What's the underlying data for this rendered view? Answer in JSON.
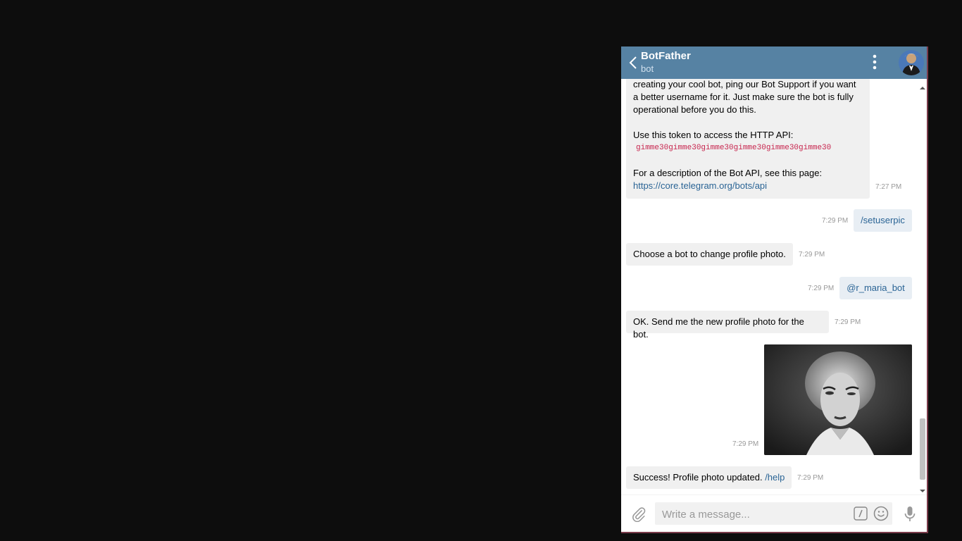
{
  "header": {
    "title": "BotFather",
    "subtitle": "bot",
    "back_icon": "chevron-left-icon",
    "menu_icon": "vertical-dots-icon",
    "bg_color": "#5682a3"
  },
  "messages": [
    {
      "id": "m1",
      "direction": "in",
      "lines": [
        "creating your cool bot, ping our Bot Support if you want",
        "a better username for it. Just make sure the bot is fully",
        "operational before you do this."
      ],
      "token_label": "Use this token to access the HTTP API:",
      "token": "gimme30gimme30gimme30gimme30gimme30gimme30",
      "api_label": "For a description of the Bot API, see this page:",
      "api_link": "https://core.telegram.org/bots/api",
      "time": "7:27 PM"
    },
    {
      "id": "m2",
      "direction": "out",
      "text": "/setuserpic",
      "time": "7:29 PM"
    },
    {
      "id": "m3",
      "direction": "in",
      "text": "Choose a bot to change profile photo.",
      "time": "7:29 PM"
    },
    {
      "id": "m4",
      "direction": "out",
      "text": "@r_maria_bot",
      "time": "7:29 PM"
    },
    {
      "id": "m5",
      "direction": "in",
      "text": "OK. Send me the new profile photo for the bot.",
      "time": "7:29 PM"
    },
    {
      "id": "m6",
      "direction": "out",
      "type": "photo",
      "time": "7:29 PM"
    },
    {
      "id": "m7",
      "direction": "in",
      "text": "Success! Profile photo updated.",
      "command": "/help",
      "time": "7:29 PM"
    }
  ],
  "composer": {
    "placeholder": "Write a message...",
    "attach_icon": "paperclip-icon",
    "command_icon": "slash-command-icon",
    "emoji_icon": "smiley-icon",
    "mic_icon": "microphone-icon"
  }
}
